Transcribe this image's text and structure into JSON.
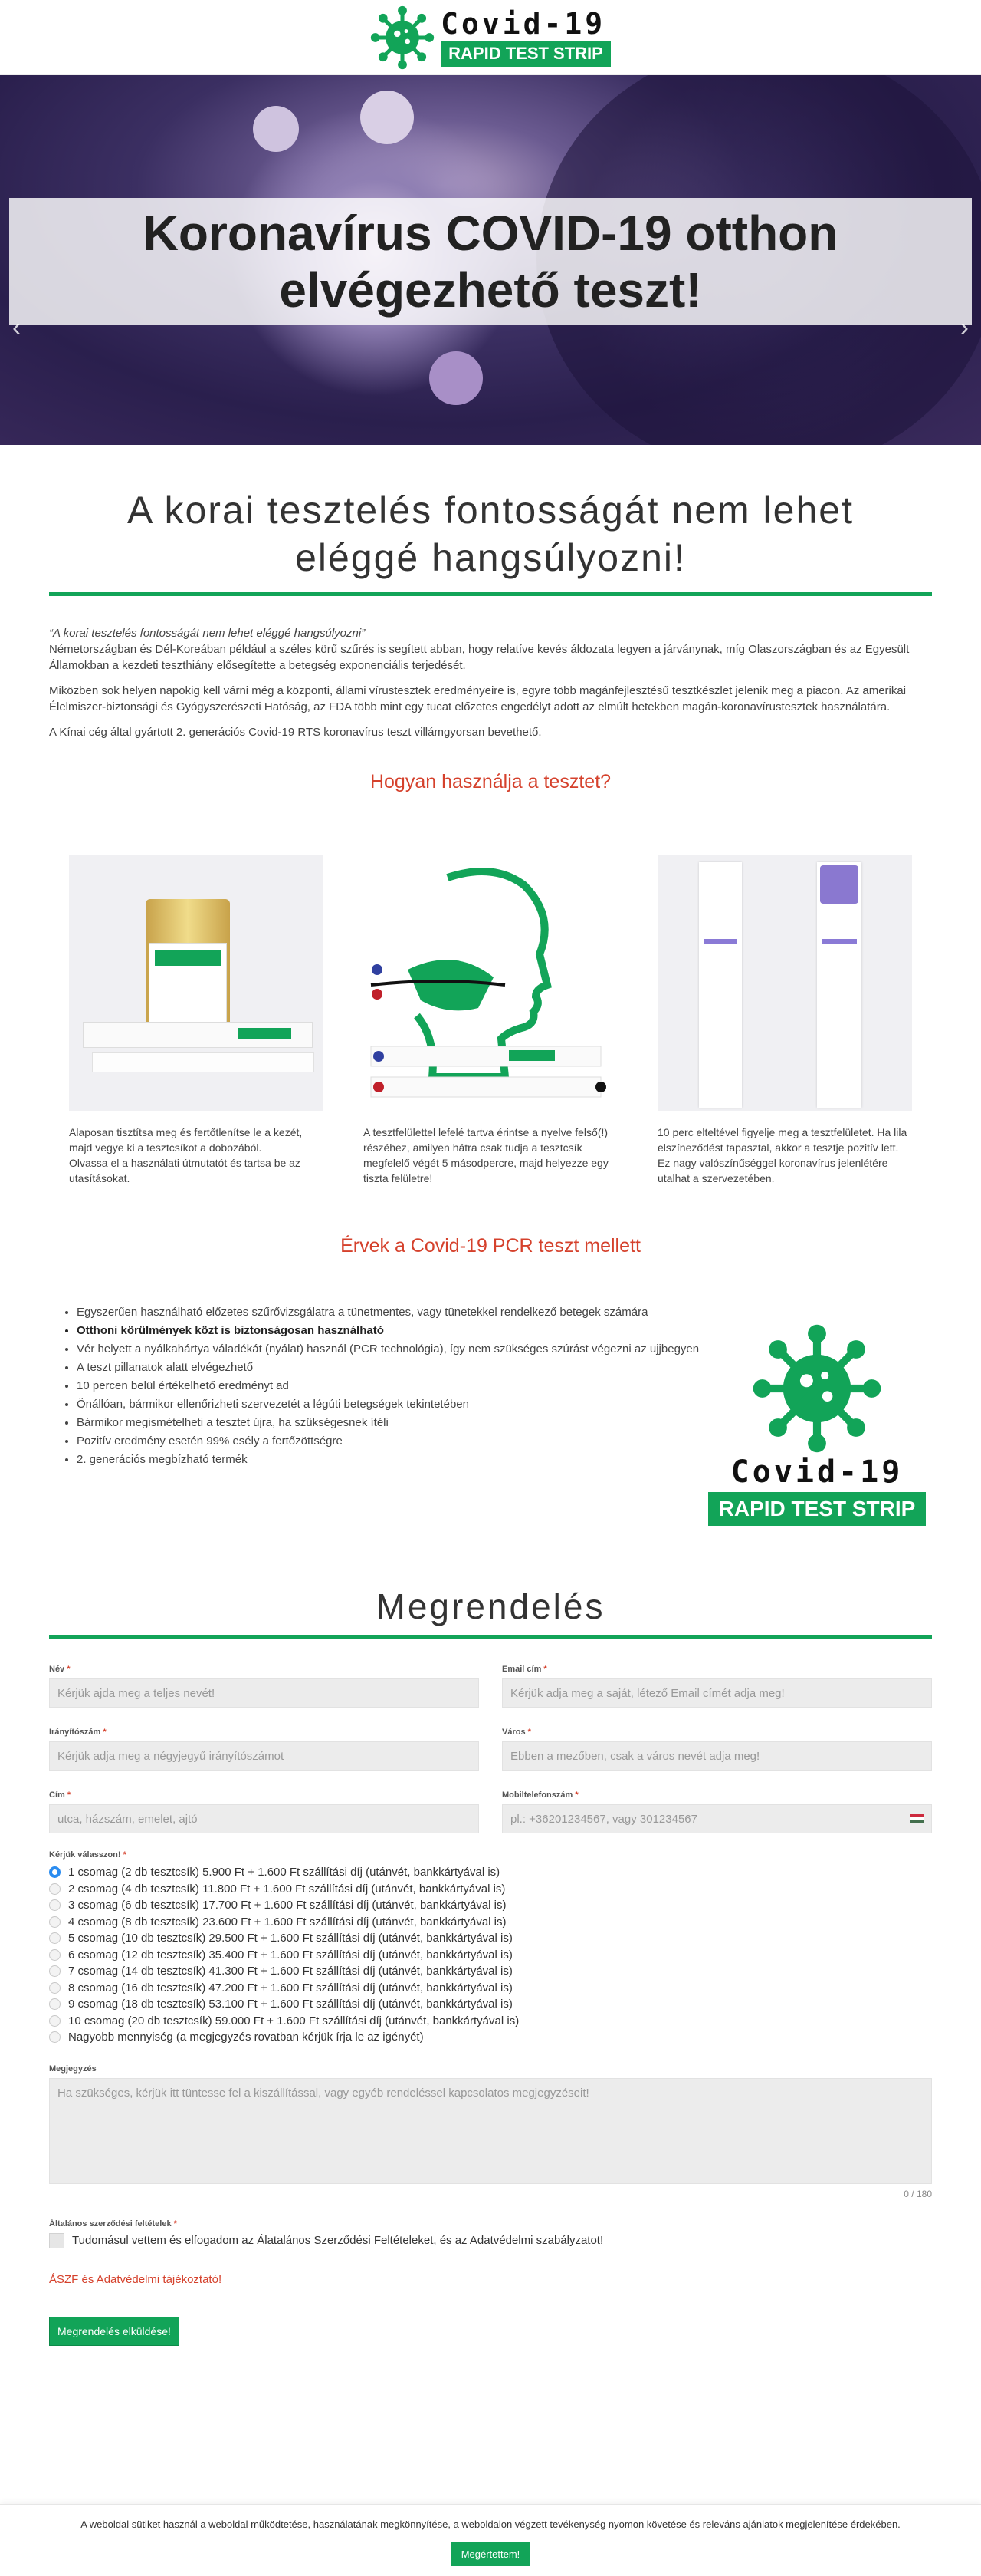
{
  "header": {
    "brand_title": "Covid-19",
    "brand_strip": "RAPID TEST STRIP"
  },
  "hero": {
    "title": "Koronavírus COVID-19 otthon elvégezhető teszt!"
  },
  "section1": {
    "title": "A korai tesztelés fontosságát nem lehet eléggé hangsúlyozni!",
    "quote": "“A korai tesztelés fontosságát nem lehet eléggé hangsúlyozni”",
    "p1": "Németországban és Dél-Koreában például a széles körű szűrés is segített abban, hogy relatíve kevés áldozata legyen a járványnak, míg Olaszországban és az Egyesült Államokban a kezdeti teszthiány elősegítette a betegség exponenciális terjedését.",
    "p2": "Miközben sok helyen napokig kell várni még a központi, állami vírustesztek eredményeire is, egyre több magánfejlesztésű tesztkészlet jelenik meg a piacon. Az amerikai Élelmiszer-biztonsági és Gyógyszerészeti Hatóság, az FDA több mint egy tucat előzetes engedélyt adott az elmúlt hetekben magán-koronavírustesztek használatára.",
    "p3": "A Kínai cég által gyártott 2. generációs Covid-19 RTS koronavírus teszt villámgyorsan bevethető."
  },
  "howto": {
    "title": "Hogyan használja a tesztet?",
    "steps": [
      {
        "text": "Alaposan tisztítsa meg és fertőtlenítse le a kezét, majd vegye ki a tesztcsíkot a dobozából.\nOlvassa el a használati útmutatót és tartsa be az utasításokat."
      },
      {
        "text": "A tesztfelülettel lefelé tartva érintse a nyelve felső(!) részéhez, amilyen hátra csak tudja a tesztcsík megfelelő végét 5 másodpercre, majd helyezze egy tiszta felületre!"
      },
      {
        "text": "10 perc elteltével figyelje meg a tesztfelületet. Ha lila elszíneződést tapasztal, akkor a tesztje pozitív lett. Ez nagy valószínűséggel koronavírus jelenlétére utalhat a szervezetében."
      }
    ]
  },
  "advantages": {
    "title": "Érvek a Covid-19 PCR teszt mellett",
    "items": [
      {
        "text": "Egyszerűen használható előzetes szűrővizsgálatra a tünetmentes, vagy tünetekkel rendelkező betegek számára",
        "bold": false
      },
      {
        "text": "Otthoni körülmények közt is biztonságosan használható",
        "bold": true
      },
      {
        "text": "Vér helyett a nyálkahártya váladékát (nyálat) használ (PCR technológia), így nem szükséges szúrást végezni az ujjbegyen",
        "bold": false
      },
      {
        "text": "A teszt pillanatok alatt elvégezhető",
        "bold": false
      },
      {
        "text": "10 percen belül értékelhető eredményt ad",
        "bold": false
      },
      {
        "text": "Önállóan, bármikor ellenőrizheti szervezetét a légúti betegségek tekintetében",
        "bold": false
      },
      {
        "text": "Bármikor megismételheti a tesztet újra, ha szükségesnek ítéli",
        "bold": false
      },
      {
        "text": "Pozitív eredmény esetén 99% esély a fertőzöttségre",
        "bold": false
      },
      {
        "text": "2. generációs megbízható termék",
        "bold": false
      }
    ]
  },
  "order": {
    "title": "Megrendelés",
    "name_label": "Név",
    "name_ph": "Kérjük ajda meg a teljes nevét!",
    "email_label": "Email cím",
    "email_ph": "Kérjük adja meg a saját, létező Email címét adja meg!",
    "zip_label": "Irányítószám",
    "zip_ph": "Kérjük adja meg a négyjegyű irányítószámot",
    "city_label": "Város",
    "city_ph": "Ebben a mezőben, csak a város nevét adja meg!",
    "addr_label": "Cím",
    "addr_ph": "utca, házszám, emelet, ajtó",
    "phone_label": "Mobiltelefonszám",
    "phone_ph": "pl.: +36201234567, vagy 301234567",
    "choose_label": "Kérjük válasszon!",
    "options": [
      "1 csomag (2 db tesztcsík) 5.900 Ft + 1.600 Ft szállítási díj (utánvét, bankkártyával is)",
      "2 csomag (4 db tesztcsík) 11.800 Ft + 1.600 Ft szállítási díj (utánvét, bankkártyával is)",
      "3 csomag (6 db tesztcsík) 17.700 Ft + 1.600 Ft szállítási díj (utánvét, bankkártyával is)",
      "4 csomag (8 db tesztcsík) 23.600 Ft + 1.600 Ft szállítási díj (utánvét, bankkártyával is)",
      "5 csomag (10 db tesztcsík) 29.500 Ft + 1.600 Ft szállítási díj (utánvét, bankkártyával is)",
      "6 csomag (12 db tesztcsík) 35.400 Ft + 1.600 Ft szállítási díj (utánvét, bankkártyával is)",
      "7 csomag (14 db tesztcsík) 41.300 Ft + 1.600 Ft szállítási díj (utánvét, bankkártyával is)",
      "8 csomag (16 db tesztcsík) 47.200 Ft + 1.600 Ft szállítási díj (utánvét, bankkártyával is)",
      "9 csomag (18 db tesztcsík) 53.100 Ft + 1.600 Ft szállítási díj (utánvét, bankkártyával is)",
      "10 csomag (20 db tesztcsík) 59.000 Ft + 1.600 Ft szállítási díj (utánvét, bankkártyával is)",
      "Nagyobb mennyiség (a megjegyzés rovatban kérjük írja le az igényét)"
    ],
    "selected_option": "1 csomag (2 db tesztcsík) 5.900 Ft + 1.600 Ft szállítási díj (utánvét, bankkártyával is)",
    "note_label": "Megjegyzés",
    "note_ph": "Ha szükséges, kérjük itt tüntesse fel a kiszállítással, vagy egyéb rendeléssel kapcsolatos megjegyzéseit!",
    "counter": "0 / 180",
    "terms_label": "Általános szerződési feltételek",
    "terms_text": "Tudomásul vettem és elfogadom az Álatalános Szerződési Feltételeket, és az Adatvédelmi szabályzatot!",
    "terms_link": "ÁSZF és Adatvédelmi tájékoztató!",
    "submit": "Megrendelés elküldése!"
  },
  "cookie": {
    "text": "A weboldal sütiket használ a weboldal működtetése, használatának megkönnyítése, a weboldalon végzett tevékenység nyomon követése és releváns ajánlatok megjelenítése érdekében.",
    "button": "Megértettem!"
  },
  "colors": {
    "accent": "#12a458",
    "red": "#d5412c"
  }
}
